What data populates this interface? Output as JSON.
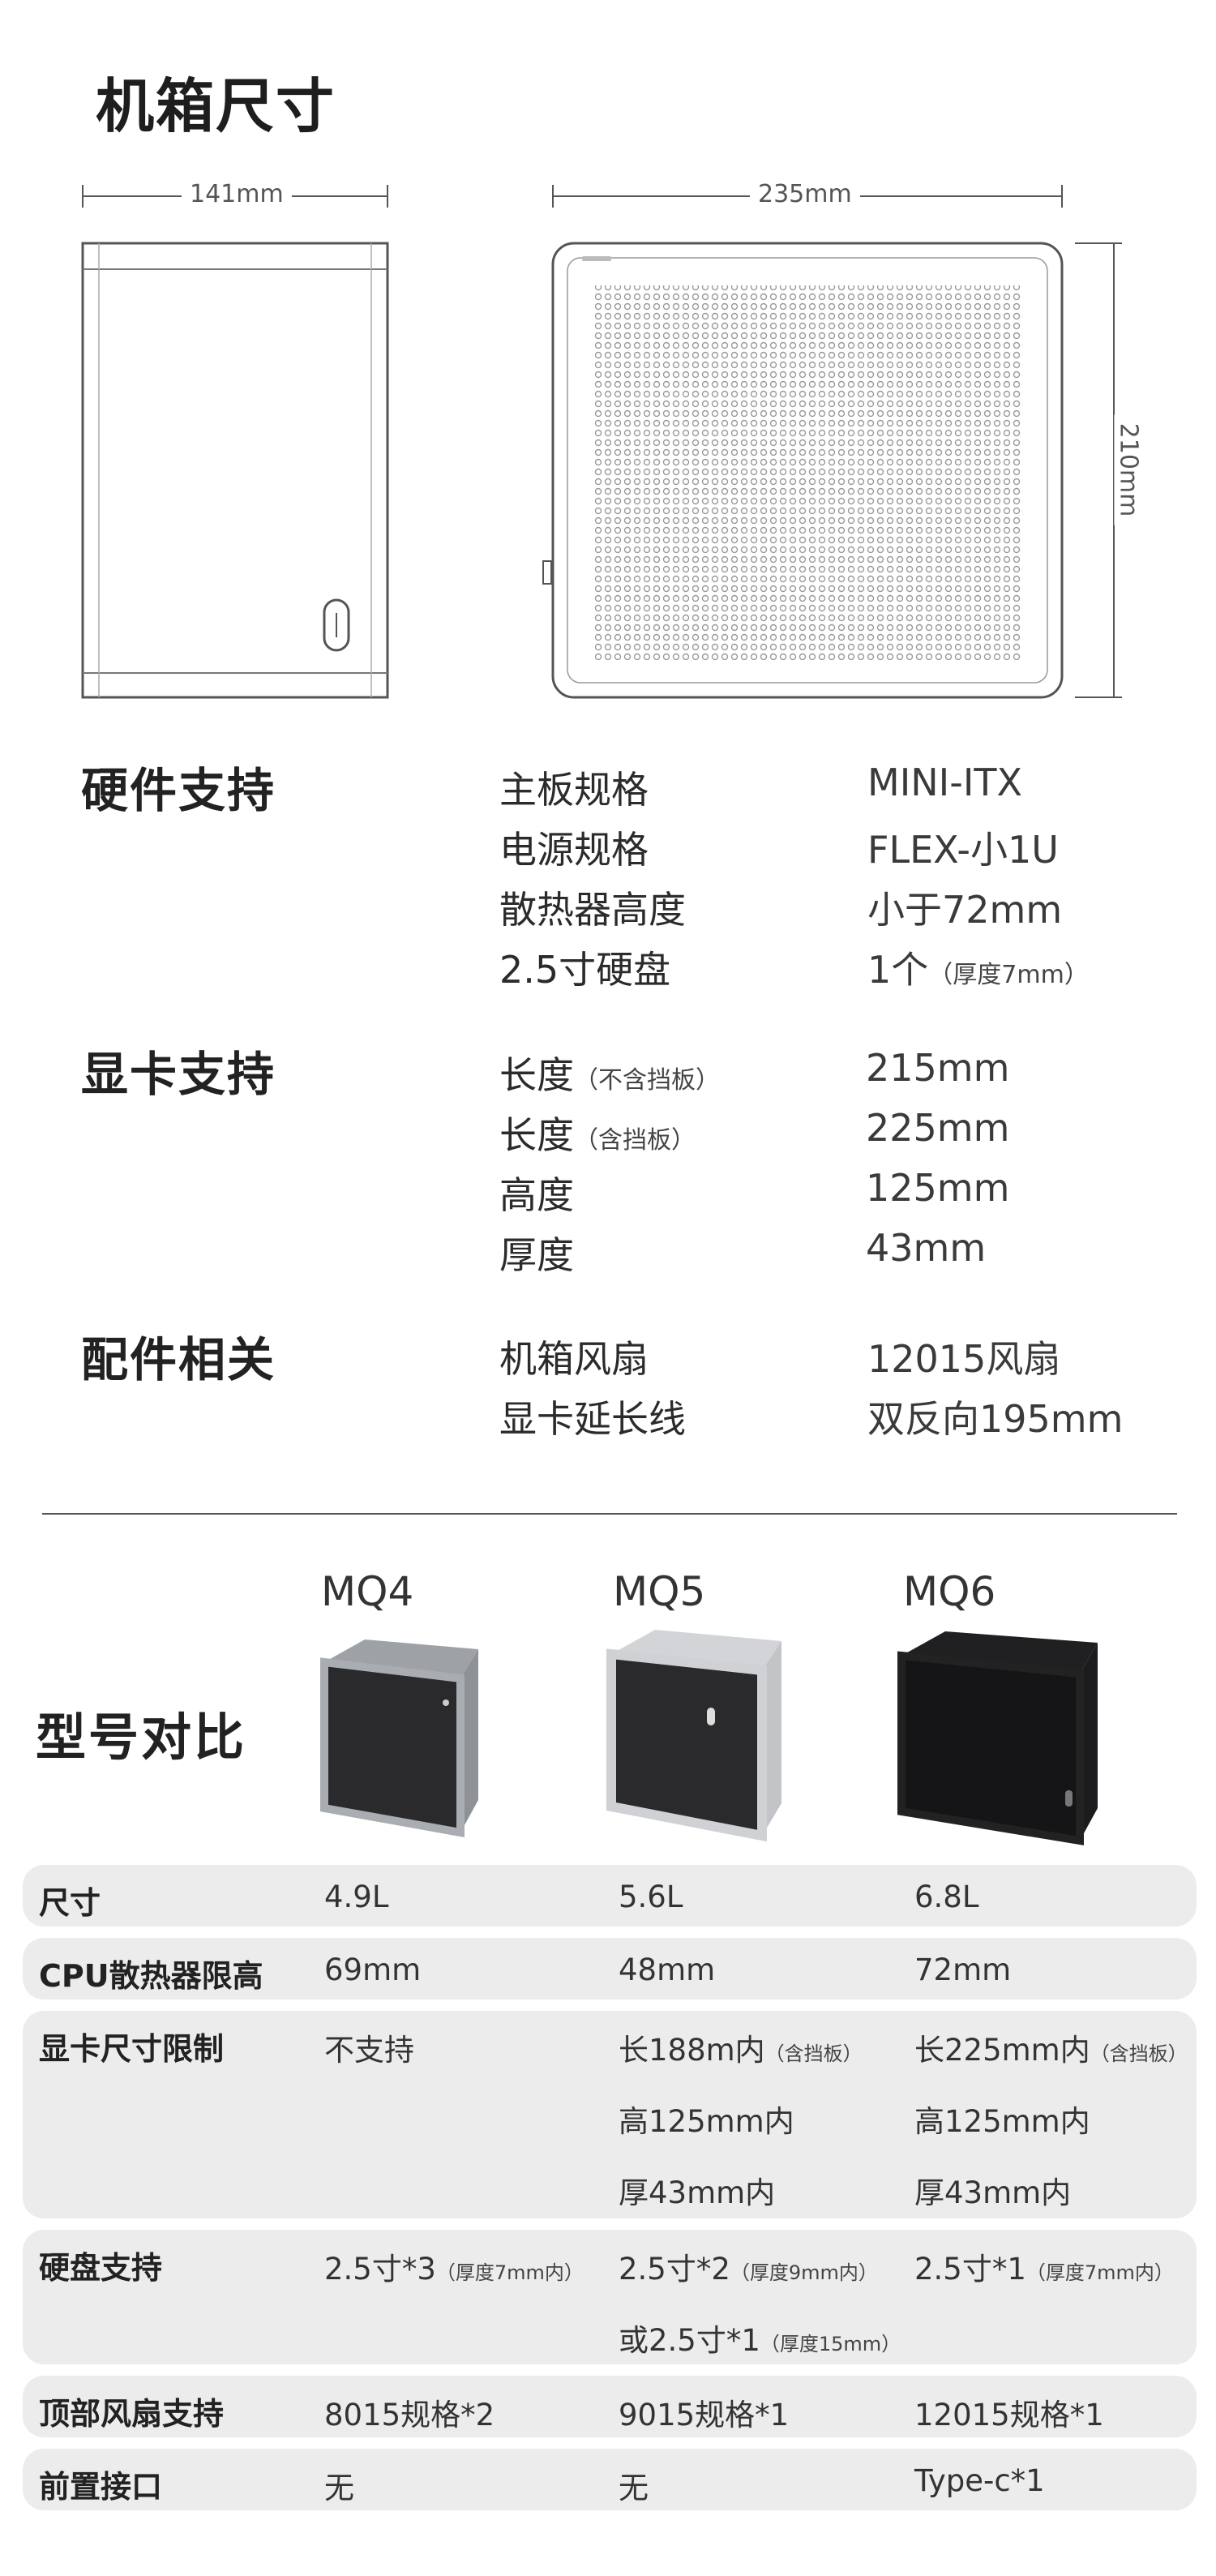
{
  "header": {
    "title": "机箱尺寸"
  },
  "dimensions": {
    "width": "141mm",
    "length": "235mm",
    "height": "210mm"
  },
  "hardware": {
    "title": "硬件支持",
    "rows": [
      {
        "label": "主板规格",
        "value": "MINI-ITX"
      },
      {
        "label": "电源规格",
        "value": "FLEX-小1U"
      },
      {
        "label": "散热器高度",
        "value": "小于72mm"
      },
      {
        "label": "2.5寸硬盘",
        "value": "1个",
        "note": "（厚度7mm）"
      }
    ]
  },
  "gpu": {
    "title": "显卡支持",
    "rows": [
      {
        "label": "长度",
        "note": "（不含挡板）",
        "value": "215mm"
      },
      {
        "label": "长度",
        "note": "（含挡板）",
        "value": "225mm"
      },
      {
        "label": "高度",
        "value": "125mm"
      },
      {
        "label": "厚度",
        "value": "43mm"
      }
    ]
  },
  "accessories": {
    "title": "配件相关",
    "rows": [
      {
        "label": "机箱风扇",
        "value": "12015风扇"
      },
      {
        "label": "显卡延长线",
        "value": "双反向195mm"
      }
    ]
  },
  "comparison": {
    "title": "型号对比",
    "models": [
      {
        "name": "MQ4",
        "body_color": "#8e9196",
        "front_color": "#2b2b2e"
      },
      {
        "name": "MQ5",
        "body_color": "#c9cbce",
        "front_color": "#2b2b2e"
      },
      {
        "name": "MQ6",
        "body_color": "#1c1c1e",
        "front_color": "#141416"
      }
    ],
    "rows": {
      "size": {
        "label": "尺寸",
        "v1": "4.9L",
        "v2": "5.6L",
        "v3": "6.8L"
      },
      "cpu": {
        "label": "CPU散热器限高",
        "v1": "69mm",
        "v2": "48mm",
        "v3": "72mm"
      },
      "gpu": {
        "label": "显卡尺寸限制",
        "v1": "不支持",
        "v2_l1": "长188m内",
        "v2_l1_note": "（含挡板）",
        "v2_l2": "高125mm内",
        "v2_l3": "厚43mm内",
        "v3_l1": "长225mm内",
        "v3_l1_note": "（含挡板）",
        "v3_l2": "高125mm内",
        "v3_l3": "厚43mm内"
      },
      "disk": {
        "label": "硬盘支持",
        "v1": "2.5寸*3",
        "v1_note": "（厚度7mm内）",
        "v2_l1": "2.5寸*2",
        "v2_l1_note": "（厚度9mm内）",
        "v2_l2": "或2.5寸*1",
        "v2_l2_note": "（厚度15mm）",
        "v3": "2.5寸*1",
        "v3_note": "（厚度7mm内）"
      },
      "fan": {
        "label": "顶部风扇支持",
        "v1": "8015规格*2",
        "v2": "9015规格*1",
        "v3": "12015规格*1"
      },
      "port": {
        "label": "前置接口",
        "v1": "无",
        "v2": "无",
        "v3": "Type-c*1"
      }
    }
  }
}
